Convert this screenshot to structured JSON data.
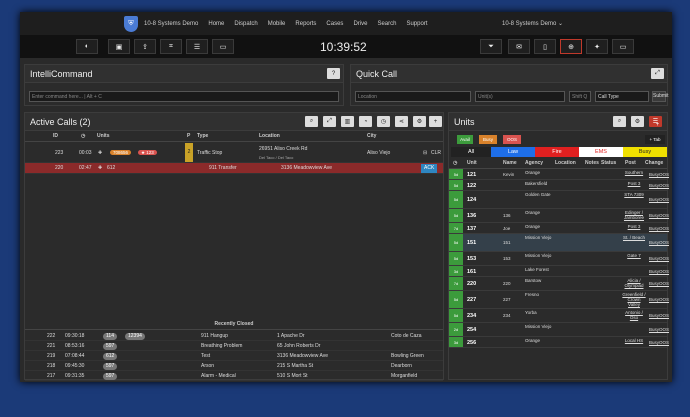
{
  "nav": {
    "brand": "10-8 Systems Demo",
    "links": [
      "Home",
      "Dispatch",
      "Mobile",
      "Reports",
      "Cases",
      "Drive",
      "Search",
      "Support"
    ],
    "org": "10-8 Systems Demo ⌄"
  },
  "toolbar": {
    "clock": "10:39:52"
  },
  "intellicommand": {
    "title": "IntelliCommand",
    "placeholder": "Enter command here... | Alt + C",
    "help": "?"
  },
  "quickcall": {
    "title": "Quick Call",
    "location_placeholder": "Location",
    "unit_placeholder": "Unit(s)",
    "shift_placeholder": "Shift Q",
    "call_type": "Call Type",
    "submit": "Submit"
  },
  "active_calls": {
    "title": "Active Calls (2)",
    "columns": [
      "ID",
      "Units",
      "P",
      "Type",
      "Location",
      "City"
    ],
    "rows": [
      {
        "id": "223",
        "time": "00:03",
        "badge1": "708656",
        "badge2": "123",
        "p": "2",
        "type": "Traffic Stop",
        "location": "26951 Aliso Creek Rd",
        "sub": "Del Taco / Del Taco",
        "city": "Aliso Viejo",
        "action": "CLR"
      },
      {
        "id": "220",
        "time": "02:47",
        "unit": "612",
        "type": "911 Transfer",
        "location": "3136 Meadowview Ave",
        "action": "ACK"
      }
    ],
    "recently_closed_title": "Recently Closed",
    "closed": [
      {
        "id": "222",
        "time": "09:30:18",
        "units": [
          "114",
          "12394"
        ],
        "type": "911 Hangup",
        "location": "1 Apache Dr",
        "city": "Coto de Caza"
      },
      {
        "id": "221",
        "time": "08:53:16",
        "units": [
          "597"
        ],
        "type": "Breathing Problem",
        "location": "65 John Roberts Dr",
        "city": ""
      },
      {
        "id": "219",
        "time": "07:08:44",
        "units": [
          "612"
        ],
        "type": "Test",
        "location": "3136 Meadowview Ave",
        "city": "Bowling Green"
      },
      {
        "id": "218",
        "time": "09:45:30",
        "units": [
          "597"
        ],
        "type": "Arson",
        "location": "215 S Martha St",
        "city": "Dearborn"
      },
      {
        "id": "217",
        "time": "09:31:35",
        "units": [
          "597"
        ],
        "type": "Alarm - Medical",
        "location": "510 S Mort St",
        "city": "Morganfield"
      }
    ]
  },
  "units": {
    "title": "Units",
    "tab_button": "+ Tab",
    "status_buttons": [
      "Avail",
      "Busy",
      "OOS"
    ],
    "filters": [
      "All",
      "Law",
      "Fire",
      "EMS",
      "Busy"
    ],
    "columns": [
      "Unit",
      "Name",
      "Agency",
      "Location",
      "Notes",
      "Status",
      "Post",
      "Change"
    ],
    "rows": [
      {
        "t": "5d",
        "unit": "121",
        "name": "Kevin",
        "agency": "Orange",
        "post": "Southern"
      },
      {
        "t": "5d",
        "unit": "122",
        "name": "",
        "agency": "Bakersfield",
        "post": "Post 3"
      },
      {
        "t": "5d",
        "unit": "124",
        "name": "",
        "agency": "Golden Gate",
        "post": "STA 7309"
      },
      {
        "t": "5d",
        "unit": "136",
        "name": "136",
        "agency": "Orange",
        "post": "Edinger / Jamboree"
      },
      {
        "t": "7d",
        "unit": "137",
        "name": "Joe",
        "agency": "Orange",
        "post": "Post 3"
      },
      {
        "t": "5d",
        "unit": "151",
        "name": "151",
        "agency": "Mission Viejo",
        "post": "St. / Beach"
      },
      {
        "t": "5d",
        "unit": "153",
        "name": "153",
        "agency": "Mission Viejo",
        "post": "Gate 7"
      },
      {
        "t": "3d",
        "unit": "161",
        "name": "",
        "agency": "Lake Forest",
        "post": ""
      },
      {
        "t": "7d",
        "unit": "220",
        "name": "220",
        "agency": "Barstow",
        "post": "Alicia / Olympiad"
      },
      {
        "t": "5d",
        "unit": "227",
        "name": "227",
        "agency": "Fresno",
        "post": "Greenfield / Crown Valley"
      },
      {
        "t": "5d",
        "unit": "234",
        "name": "234",
        "agency": "Yorba",
        "post": "Antonio / Oso"
      },
      {
        "t": "2d",
        "unit": "254",
        "name": "",
        "agency": "Mission Viejo",
        "post": ""
      },
      {
        "t": "3d",
        "unit": "256",
        "name": "",
        "agency": "Orange",
        "post": "Local HS"
      }
    ],
    "busy": "Busy",
    "oos": "OOS"
  },
  "colors": {
    "law": "#1e6ee8",
    "fire": "#e02020",
    "ems": "#ffffff",
    "busy": "#f0e000",
    "avail": "#3c9b3c"
  }
}
